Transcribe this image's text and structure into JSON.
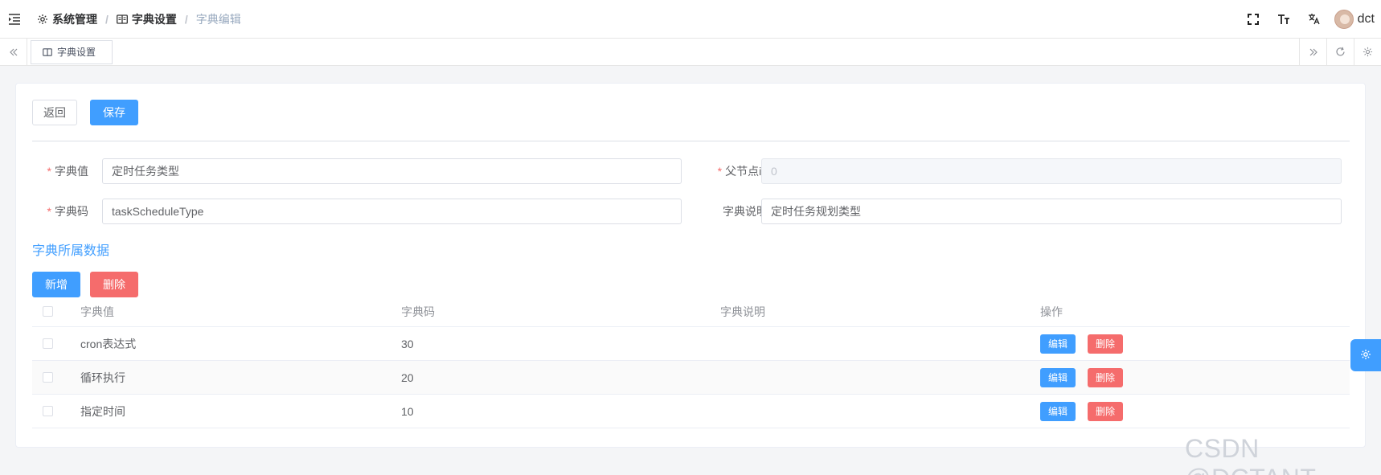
{
  "header": {
    "breadcrumb": [
      {
        "label": "系统管理",
        "icon": "gear-icon"
      },
      {
        "label": "字典设置",
        "icon": "book-icon"
      },
      {
        "label": "字典编辑"
      }
    ],
    "separator": "/",
    "username": "dct",
    "icons": [
      "menu-fold-icon",
      "fullscreen-icon",
      "font-size-icon",
      "translate-icon"
    ]
  },
  "tabs": {
    "items": [
      {
        "label": "字典设置",
        "icon": "book-icon"
      }
    ],
    "nav_icons": [
      "double-left-icon",
      "double-right-icon",
      "refresh-icon",
      "settings-icon"
    ]
  },
  "toolbar": {
    "back_label": "返回",
    "save_label": "保存"
  },
  "form": {
    "dict_value": {
      "label": "字典值",
      "required": true,
      "value": "定时任务类型"
    },
    "parent_id": {
      "label": "父节点id",
      "required": true,
      "value": "0",
      "disabled": true
    },
    "dict_code": {
      "label": "字典码",
      "required": true,
      "value": "taskScheduleType"
    },
    "dict_desc": {
      "label": "字典说明",
      "required": false,
      "value": "定时任务规划类型"
    }
  },
  "section": {
    "title": "字典所属数据",
    "add_label": "新增",
    "delete_label": "删除"
  },
  "table": {
    "columns": [
      "字典值",
      "字典码",
      "字典说明",
      "操作"
    ],
    "rows": [
      {
        "value": "cron表达式",
        "code": "30",
        "desc": "",
        "edit": "编辑",
        "delete": "删除"
      },
      {
        "value": "循环执行",
        "code": "20",
        "desc": "",
        "edit": "编辑",
        "delete": "删除"
      },
      {
        "value": "指定时间",
        "code": "10",
        "desc": "",
        "edit": "编辑",
        "delete": "删除"
      }
    ]
  },
  "watermark": "CSDN @DCTANT",
  "colors": {
    "primary": "#409eff",
    "danger": "#f56c6c",
    "required": "#f56c6c"
  }
}
